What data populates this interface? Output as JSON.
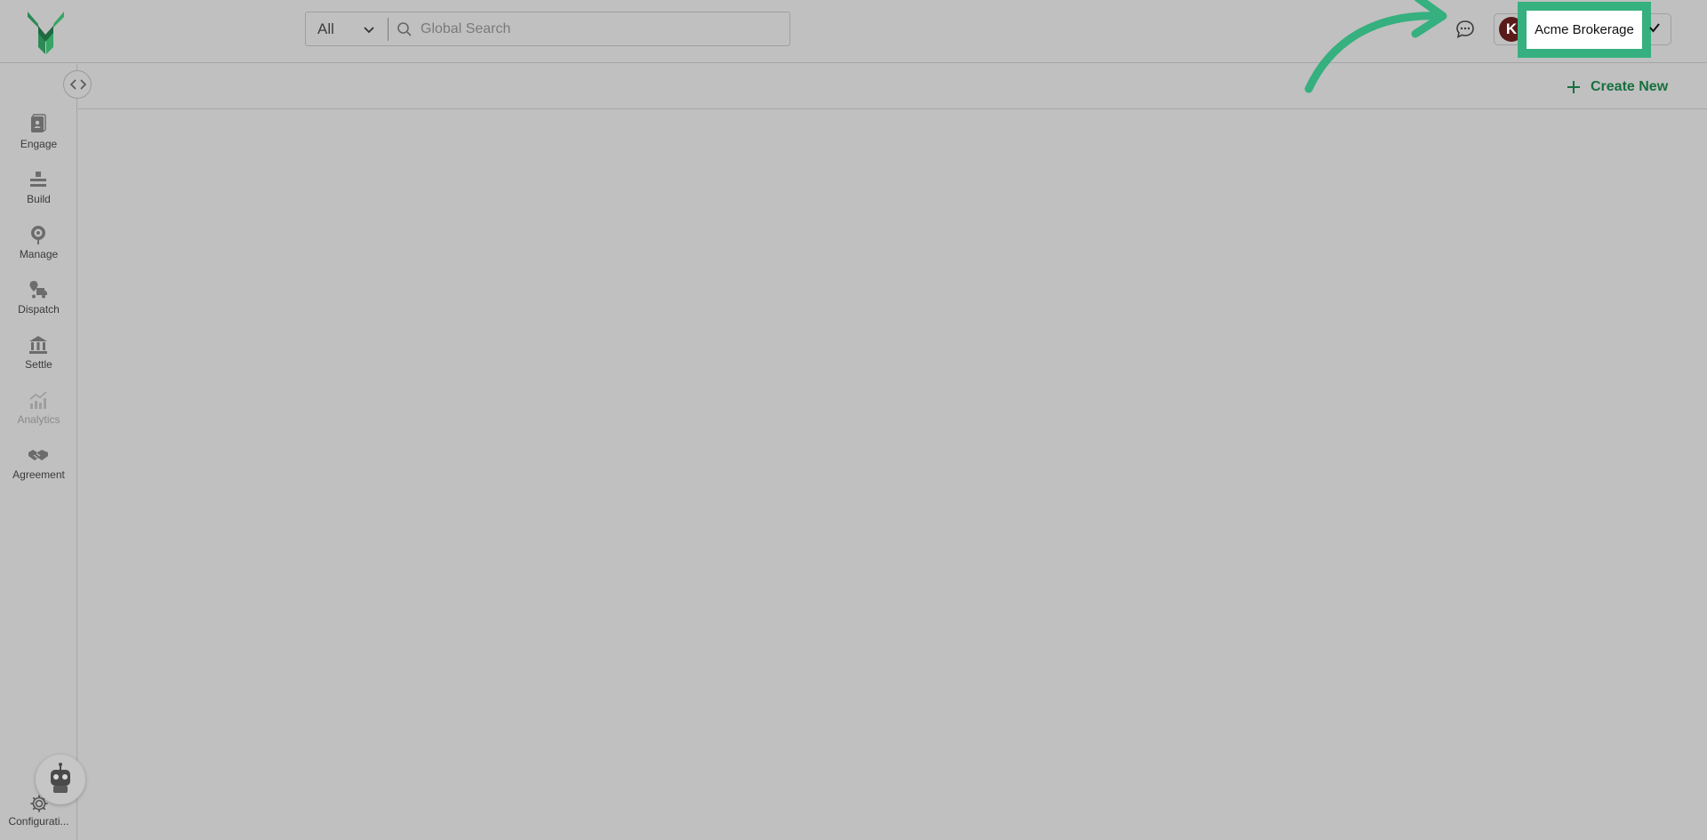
{
  "header": {
    "search": {
      "scope": "All",
      "placeholder": "Global Search"
    },
    "account": {
      "avatar_initials": "K",
      "org_name": "Acme Brokerage"
    }
  },
  "sidebar": {
    "items": [
      {
        "label": "Engage",
        "icon": "engage-icon",
        "enabled": true
      },
      {
        "label": "Build",
        "icon": "build-icon",
        "enabled": true
      },
      {
        "label": "Manage",
        "icon": "manage-icon",
        "enabled": true
      },
      {
        "label": "Dispatch",
        "icon": "dispatch-icon",
        "enabled": true
      },
      {
        "label": "Settle",
        "icon": "settle-icon",
        "enabled": true
      },
      {
        "label": "Analytics",
        "icon": "analytics-icon",
        "enabled": false
      },
      {
        "label": "Agreement",
        "icon": "agreement-icon",
        "enabled": true
      }
    ],
    "config_label": "Configurati..."
  },
  "toolbar": {
    "create_label": "Create New"
  },
  "colors": {
    "accent": "#17703f",
    "highlight": "#35b07e",
    "overlay_bg": "#c0c0c0"
  }
}
